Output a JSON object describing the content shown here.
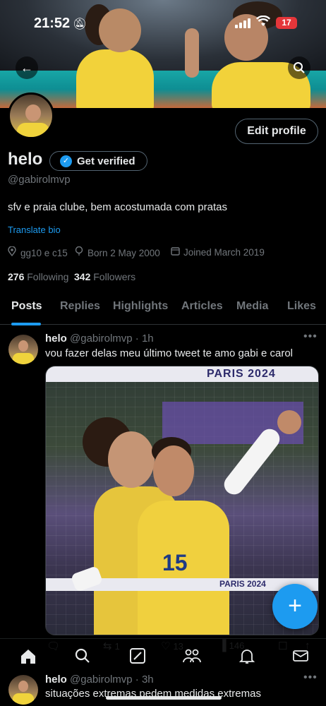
{
  "status_bar": {
    "time": "21:52",
    "battery": "17"
  },
  "profile": {
    "name": "helo",
    "verify_label": "Get verified",
    "handle": "@gabirolmvp",
    "bio": "sfv e praia clube, bem acostumada com pratas",
    "translate_label": "Translate bio",
    "location": "gg10 e c15",
    "born": "Born 2 May 2000",
    "joined": "Joined March 2019",
    "following_count": "276",
    "following_label": "Following",
    "followers_count": "342",
    "followers_label": "Followers",
    "edit_label": "Edit profile"
  },
  "tabs": [
    {
      "label": "Posts"
    },
    {
      "label": "Replies"
    },
    {
      "label": "Highlights"
    },
    {
      "label": "Articles"
    },
    {
      "label": "Media"
    },
    {
      "label": "Likes"
    }
  ],
  "tweets": [
    {
      "name": "helo",
      "handle_time": "@gabirolmvp · 1h",
      "text": "vou fazer delas meu último tweet te amo gabi e carol",
      "media": {
        "top_banner": "PARIS 2024",
        "net_band": "PARIS 2024",
        "jersey_number": "15"
      },
      "actions": {
        "replies": "",
        "reposts": "1",
        "likes": "13",
        "views": "146"
      }
    },
    {
      "name": "helo",
      "handle_time": "@gabirolmvp · 3h",
      "text": "situações extremas pedem medidas extremas"
    }
  ],
  "fab_label": "+",
  "icons": {
    "back": "arrow-left-icon",
    "search": "search-icon",
    "home": "home-icon",
    "explore": "search-icon",
    "grok": "grok-icon",
    "communities": "communities-icon",
    "notifications": "bell-icon",
    "messages": "mail-icon"
  },
  "colors": {
    "accent": "#1d9bf0",
    "background": "#000000",
    "secondary_text": "#71767b"
  }
}
